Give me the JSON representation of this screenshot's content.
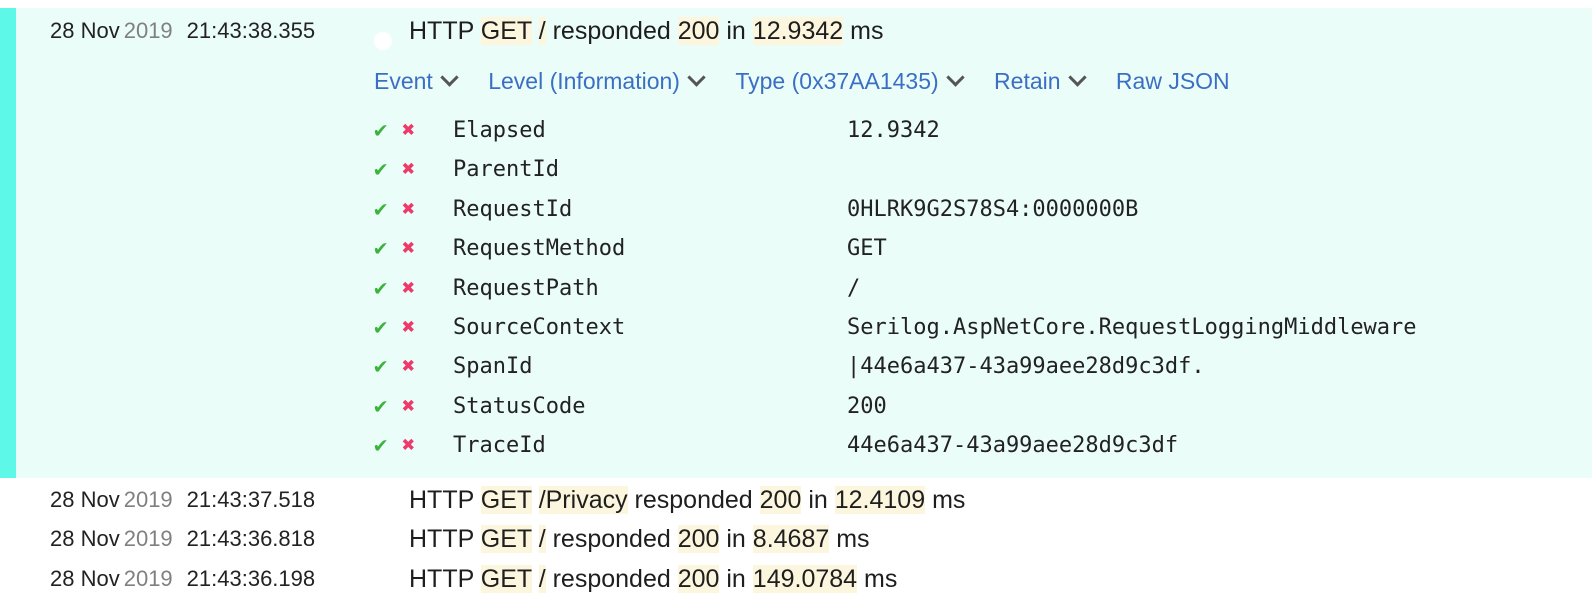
{
  "accent_color": "#5ef8e8",
  "expanded_event": {
    "date_day": "28 Nov",
    "date_year": "2019",
    "time": "21:43:38.355",
    "message": {
      "prefix": "HTTP",
      "method": "GET",
      "path": "/",
      "mid": "responded",
      "status": "200",
      "in": "in",
      "elapsed": "12.9342",
      "unit": "ms"
    },
    "actions": [
      {
        "label": "Event",
        "dropdown": true
      },
      {
        "label": "Level (Information)",
        "dropdown": true
      },
      {
        "label": "Type (0x37AA1435)",
        "dropdown": true
      },
      {
        "label": "Retain",
        "dropdown": true
      },
      {
        "label": "Raw JSON",
        "dropdown": false
      }
    ],
    "properties": [
      {
        "name": "Elapsed",
        "value": "12.9342"
      },
      {
        "name": "ParentId",
        "value": ""
      },
      {
        "name": "RequestId",
        "value": "0HLRK9G2S78S4:0000000B"
      },
      {
        "name": "RequestMethod",
        "value": "GET"
      },
      {
        "name": "RequestPath",
        "value": "/"
      },
      {
        "name": "SourceContext",
        "value": "Serilog.AspNetCore.RequestLoggingMiddleware"
      },
      {
        "name": "SpanId",
        "value": "|44e6a437-43a99aee28d9c3df."
      },
      {
        "name": "StatusCode",
        "value": "200"
      },
      {
        "name": "TraceId",
        "value": "44e6a437-43a99aee28d9c3df"
      }
    ]
  },
  "events": [
    {
      "date_day": "28 Nov",
      "date_year": "2019",
      "time": "21:43:37.518",
      "message": {
        "prefix": "HTTP",
        "method": "GET",
        "path": "/Privacy",
        "mid": "responded",
        "status": "200",
        "in": "in",
        "elapsed": "12.4109",
        "unit": "ms"
      }
    },
    {
      "date_day": "28 Nov",
      "date_year": "2019",
      "time": "21:43:36.818",
      "message": {
        "prefix": "HTTP",
        "method": "GET",
        "path": "/",
        "mid": "responded",
        "status": "200",
        "in": "in",
        "elapsed": "8.4687",
        "unit": "ms"
      }
    },
    {
      "date_day": "28 Nov",
      "date_year": "2019",
      "time": "21:43:36.198",
      "message": {
        "prefix": "HTTP",
        "method": "GET",
        "path": "/",
        "mid": "responded",
        "status": "200",
        "in": "in",
        "elapsed": "149.0784",
        "unit": "ms"
      }
    }
  ]
}
